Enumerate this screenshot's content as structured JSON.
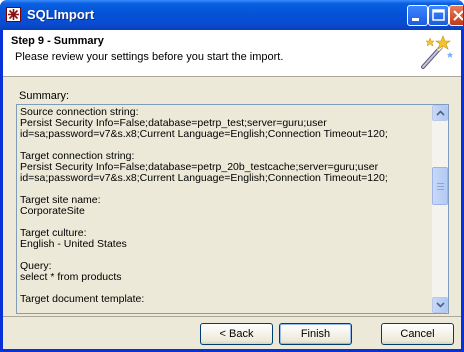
{
  "window": {
    "title": "SQLImport"
  },
  "header": {
    "step_title": "Step 9 - Summary",
    "step_description": "Please review your settings before you start the import."
  },
  "summary": {
    "label": "Summary:",
    "text": "Source connection string:\nPersist Security Info=False;database=petrp_test;server=guru;user id=sa;password=v7&s.x8;Current Language=English;Connection Timeout=120;\n\nTarget connection string:\nPersist Security Info=False;database=petrp_20b_testcache;server=guru;user id=sa;password=v7&s.x8;Current Language=English;Connection Timeout=120;\n\nTarget site name:\nCorporateSite\n\nTarget culture:\nEnglish - United States\n\nQuery:\nselect * from products\n\nTarget document template:"
  },
  "buttons": {
    "back": "< Back",
    "finish": "Finish",
    "cancel": "Cancel"
  },
  "colors": {
    "title_bar": "#0453d8",
    "window_frame": "#0831d9",
    "dialog_background": "#ece9d8"
  },
  "icons": {
    "app": "sqlimport-app-icon",
    "header": "magic-wand-icon",
    "minimize": "minimize-icon",
    "maximize": "maximize-icon",
    "close": "close-icon",
    "scroll_up": "scroll-up-arrow-icon",
    "scroll_down": "scroll-down-arrow-icon"
  }
}
